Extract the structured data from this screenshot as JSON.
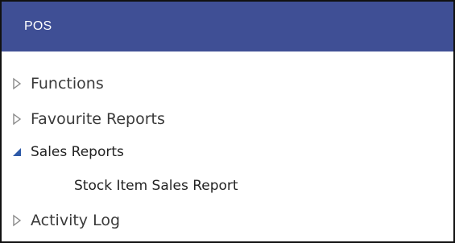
{
  "panel": {
    "title": "POS"
  },
  "tree": {
    "items": [
      {
        "label": "Functions",
        "state": "collapsed"
      },
      {
        "label": "Favourite Reports",
        "state": "collapsed"
      },
      {
        "label": "Sales Reports",
        "state": "expanded",
        "children": [
          {
            "label": "Stock Item Sales Report"
          }
        ]
      },
      {
        "label": "Activity Log",
        "state": "collapsed"
      }
    ]
  },
  "colors": {
    "header_bg": "#3f4f95",
    "header_text": "#ffffff",
    "expanded_arrow": "#2e5aa8",
    "collapsed_arrow": "#8a8a8a"
  }
}
